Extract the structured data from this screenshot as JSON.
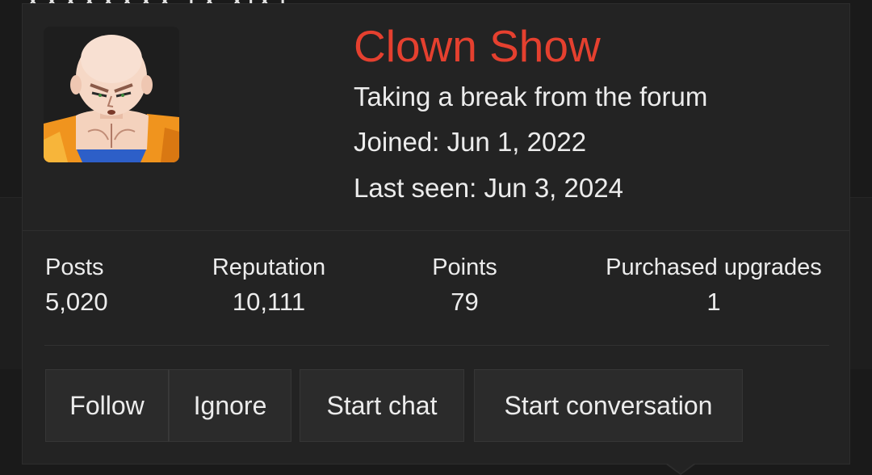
{
  "profile": {
    "name": "Clown Show",
    "user_title": "Taking a break from the forum",
    "joined": "Joined: Jun 1, 2022",
    "last_seen": "Last seen: Jun 3, 2024",
    "name_color": "#e5402f",
    "avatar_icon": "anime-character-avatar"
  },
  "background": {
    "peek_text": "XXXXXXXX TX XIXT"
  },
  "stats": [
    {
      "label": "Posts",
      "value": "5,020"
    },
    {
      "label": "Reputation",
      "value": "10,111"
    },
    {
      "label": "Points",
      "value": "79"
    },
    {
      "label": "Purchased upgrades",
      "value": "1"
    }
  ],
  "actions": {
    "follow": "Follow",
    "ignore": "Ignore",
    "start_chat": "Start chat",
    "start_conversation": "Start conversation"
  }
}
